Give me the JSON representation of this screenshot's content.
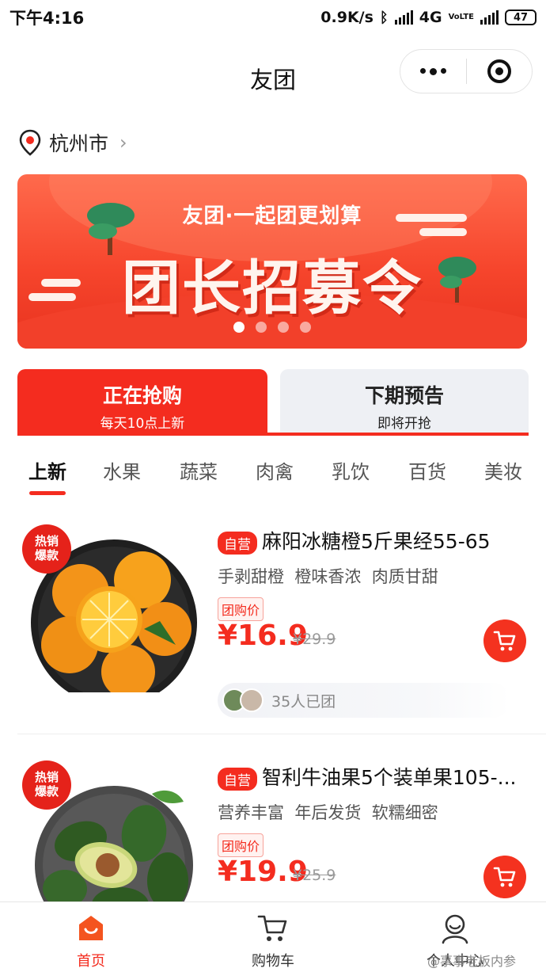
{
  "status_bar": {
    "time": "下午4:16",
    "net_speed": "0.9K/s",
    "network": "4G",
    "volte": "VoLTE",
    "battery": "47"
  },
  "title_bar": {
    "title": "友团"
  },
  "location": {
    "city": "杭州市"
  },
  "banner": {
    "slogan": "友团·一起团更划算",
    "headline": "团长招募令",
    "slide_count": 4,
    "active_slide": 1
  },
  "sale_tabs": [
    {
      "title": "正在抢购",
      "subtitle": "每天10点上新"
    },
    {
      "title": "下期预告",
      "subtitle": "即将开抢"
    }
  ],
  "category_tabs": [
    "上新",
    "水果",
    "蔬菜",
    "肉禽",
    "乳饮",
    "百货",
    "美妆"
  ],
  "products": [
    {
      "badge": "热销爆款",
      "tag": "自营",
      "name": "麻阳冰糖橙5斤果经55-65",
      "description": "手剥甜橙  橙味香浓  肉质甘甜",
      "price_tag": "团购价",
      "price": "¥16.9",
      "original_price": "¥29.9",
      "joined": "35人已团"
    },
    {
      "badge": "热销爆款",
      "tag": "自营",
      "name": "智利牛油果5个装单果105-...",
      "description": "营养丰富  年后发货  软糯细密",
      "price_tag": "团购价",
      "price": "¥19.9",
      "original_price": "¥25.9"
    }
  ],
  "bottom_nav": [
    {
      "label": "首页",
      "icon": "home-icon"
    },
    {
      "label": "购物车",
      "icon": "cart-icon"
    },
    {
      "label": "个人中心",
      "icon": "user-icon"
    }
  ],
  "watermark": "@事事老板内参",
  "colors": {
    "accent": "#f42c1f",
    "banner": "#f6452c",
    "inactive_tab": "#eef0f4"
  }
}
